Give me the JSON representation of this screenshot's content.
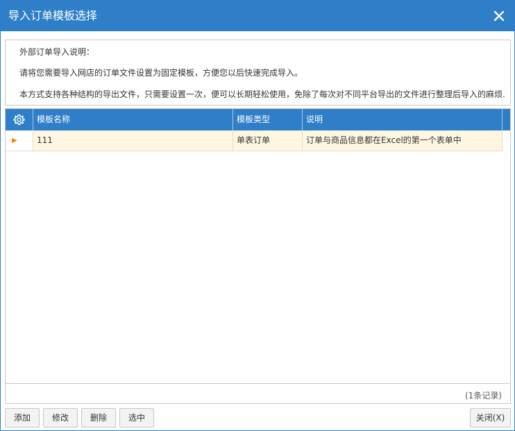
{
  "dialog": {
    "title": "导入订单模板选择",
    "close_icon": "close-icon"
  },
  "info": {
    "line1": "外部订单导入说明：",
    "line2": "请将您需要导入网店的订单文件设置为固定模板，方便您以后快速完成导入。",
    "line3": "本方式支持各种结构的导出文件，只需要设置一次，便可以长期轻松使用，免除了每次对不同平台导出的文件进行整理后导入的麻烦."
  },
  "grid": {
    "settings_icon": "gear-icon",
    "columns": {
      "name": "模板名称",
      "type": "模板类型",
      "desc": "说明"
    },
    "rows": [
      {
        "indicator_icon": "play-arrow-icon",
        "name": "111",
        "type": "单表订单",
        "desc": "订单与商品信息都在Excel的第一个表单中"
      }
    ],
    "record_count": "(1条记录)"
  },
  "buttons": {
    "add": "添加",
    "edit": "修改",
    "delete": "删除",
    "select": "选中",
    "close": "关闭(X)"
  },
  "colors": {
    "header_blue": "#2e7fc8",
    "selected_row": "#fdf7e2",
    "indicator": "#f08a00"
  }
}
